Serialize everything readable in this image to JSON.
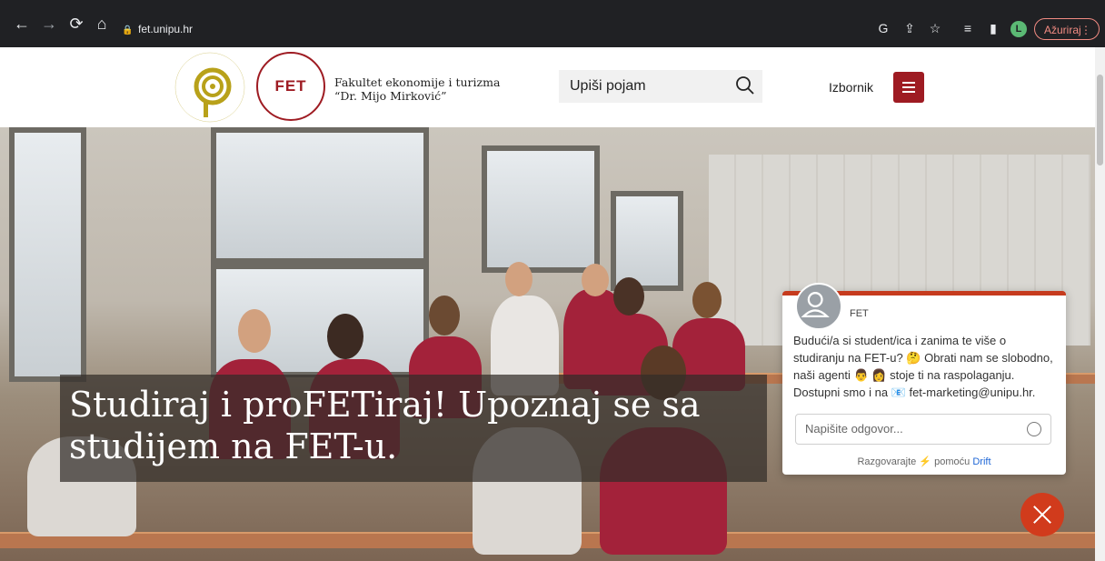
{
  "browser": {
    "url": "fet.unipu.hr",
    "update_label": "Ažuriraj",
    "profile_initial": "L"
  },
  "header": {
    "uni_logo_text": "SVEUČILIŠTE JURJA DOBRILE U PULI",
    "fet_logo": "FET",
    "faculty_line1": "Fakultet ekonomije i turizma",
    "faculty_line2": "“Dr. Mijo Mirković”",
    "search_placeholder": "Upiši pojam",
    "menu_label": "Izbornik"
  },
  "hero": {
    "headline": "Studiraj i proFETiraj! Upoznaj se sa studijem na FET-u."
  },
  "chat": {
    "agent_name": "FET",
    "message_part1": "Budući/a si student/ica i zanima te više o studiranju na FET-u? 🤔 Obrati nam se slobodno, naši agenti 👨 👩 stoje ti na raspolaganju. Dostupni smo i na 📧 fet-marketing@unipu.hr.",
    "reply_placeholder": "Napišite odgovor...",
    "powered_prefix": "Razgovarajte",
    "powered_middle": "pomoću",
    "powered_brand": "Drift"
  },
  "colors": {
    "brand_red": "#9e1b22",
    "chat_accent": "#c63b1e",
    "drift_blue": "#1e66d6"
  },
  "icons": [
    "back-icon",
    "forward-icon",
    "reload-icon",
    "home-icon",
    "lock-icon",
    "google-icon",
    "share-icon",
    "star-icon",
    "reading-list-icon",
    "side-panel-icon",
    "search-icon",
    "hamburger-icon",
    "user-icon",
    "emoji-icon",
    "close-icon"
  ]
}
